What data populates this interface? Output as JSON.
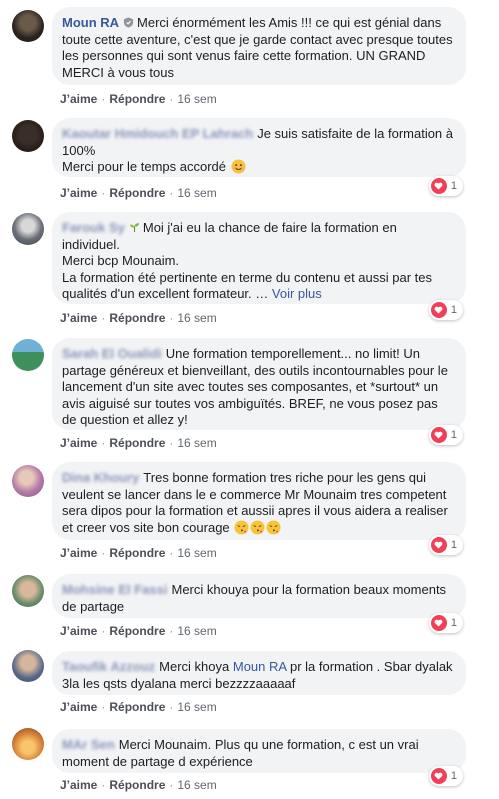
{
  "actions": {
    "like_label": "J’aime",
    "reply_label": "Répondre",
    "separator": "·"
  },
  "comments": [
    {
      "author": "Moun RA",
      "text": "Merci énormément les Amis !!! ce qui est génial dans toute cette aventure, c'est que je garde contact avec presque toutes les personnes qui sont venus faire cette formation. UN GRAND MERCI à vous tous",
      "time": "16 sem"
    },
    {
      "author": "Kaoutar Hmidouch EP Lahrach",
      "text_line1": "Je suis satisfaite de la formation à 100%",
      "text_line2": "Merci pour le temps accordé",
      "time": "16 sem",
      "reaction_count": "1"
    },
    {
      "author": "Farouk Sy",
      "text_line1": "Moi j'ai eu la chance de faire la formation en individuel.",
      "text_line2": "Merci bcp Mounaim.",
      "text_line3": "La formation été pertinente en terme du contenu et aussi par tes qualités d'un excellent formateur.",
      "ellipsis": " … ",
      "see_more": "Voir plus",
      "time": "16 sem",
      "reaction_count": "1"
    },
    {
      "author": "Sarah El Oualidi",
      "text": "Une formation temporellement... no limit! Un partage généreux et bienveillant, des outils incontournables pour le lancement d'un site avec toutes ses composantes, et *surtout* un avis aiguisé sur toutes vos ambiguïtés. BREF, ne vous posez pas de question et allez y!",
      "time": "16 sem",
      "reaction_count": "1"
    },
    {
      "author": "Dina Khoury",
      "text": "Tres bonne formation tres riche pour les gens qui veulent se lancer dans le e commerce Mr Mounaim tres competent sera dipos pour la formation et aussii apres il vous aidera a realiser et creer vos site bon courage",
      "time": "16 sem",
      "reaction_count": "1"
    },
    {
      "author": "Mohsine El Fassi",
      "text": "Merci khouya pour la formation beaux moments de partage",
      "time": "16 sem",
      "reaction_count": "1"
    },
    {
      "author": "Taoufik Azzouz",
      "text_before": "Merci khoya",
      "mention": "Moun RA",
      "text_after": "pr la formation . Sbar dyalak 3la les qsts dyalana merci bezzzzaaaaaf",
      "time": "16 sem"
    },
    {
      "author": "MAr Sen",
      "text": "Merci Mounaim. Plus qu une formation, c est un vrai moment de partage d expérience",
      "time": "16 sem",
      "reaction_count": "1"
    }
  ],
  "colors": {
    "bubble": "#f2f3f5",
    "link": "#385898",
    "heart": "#f33e58"
  },
  "icons": {
    "badge": "shield-icon",
    "reaction": "heart-icon",
    "emoji_smile": "smiling-face-icon",
    "emoji_kiss": "face-blowing-kiss-icon",
    "plant": "seedling-icon"
  }
}
